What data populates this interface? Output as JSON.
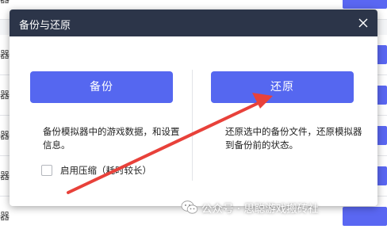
{
  "dialog": {
    "title": "备份与还原",
    "backup": {
      "button_label": "备份",
      "description": "备份模拟器中的游戏数据，和设置信息。",
      "compress_label": "启用压缩（耗时较长）",
      "compress_checked": false
    },
    "restore": {
      "button_label": "还原",
      "description": "还原选中的备份文件，还原模拟器到备份前的状态。"
    }
  },
  "background": {
    "row_prefix": "器"
  },
  "watermark": {
    "text": "公众号 · 思聪游戏搬砖社"
  },
  "colors": {
    "titlebar": "#2c3549",
    "primary_button": "#5567f0",
    "annotation_arrow": "#e8413a"
  },
  "icons": {
    "close": "close-icon",
    "checkbox": "checkbox-icon",
    "arrow": "red-arrow-annotation",
    "watermark": "wechat-icon"
  }
}
